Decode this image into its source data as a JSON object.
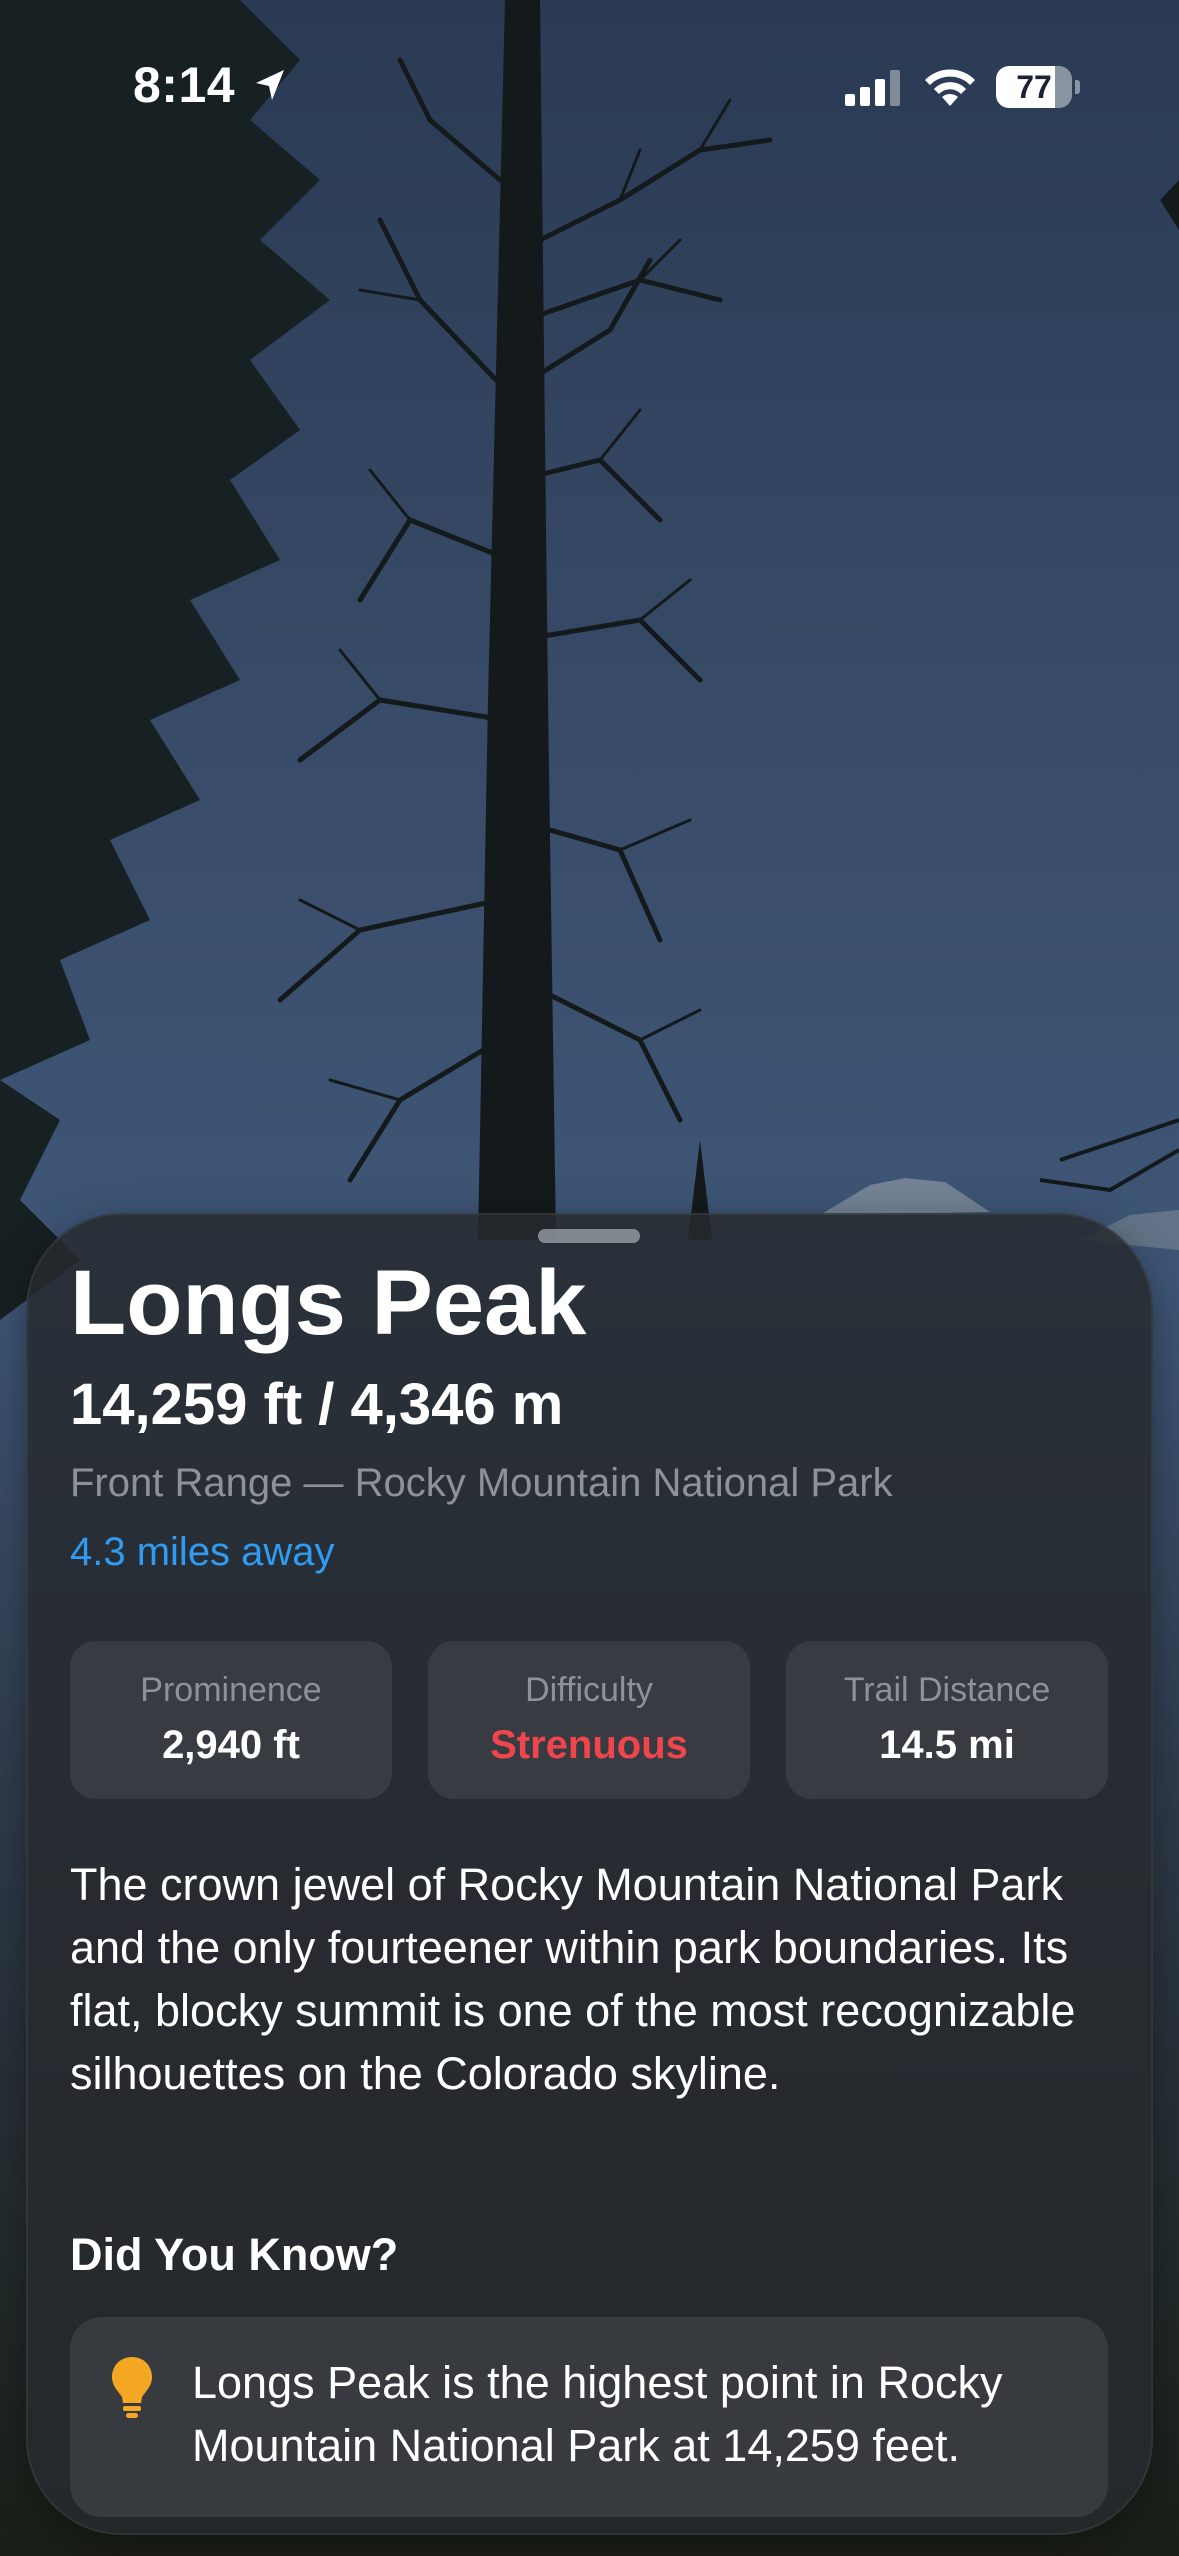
{
  "status_bar": {
    "time": "8:14",
    "battery_level": "77",
    "battery_fraction": 0.77
  },
  "icons": {
    "location": "location-arrow-icon",
    "signal": "cellular-signal-icon",
    "wifi": "wifi-icon",
    "battery": "battery-icon",
    "tip": "lightbulb-icon"
  },
  "peak": {
    "name": "Longs Peak",
    "elevation": "14,259 ft / 4,346 m",
    "range": "Front Range — Rocky Mountain National Park",
    "distance": "4.3 miles away"
  },
  "stats": [
    {
      "label": "Prominence",
      "value": "2,940 ft"
    },
    {
      "label": "Difficulty",
      "value": "Strenuous"
    },
    {
      "label": "Trail Distance",
      "value": "14.5 mi"
    }
  ],
  "description": "The crown jewel of Rocky Mountain National Park and the only fourteener within park boundaries. Its flat, blocky summit is one of the most recognizable silhouettes on the Colorado skyline.",
  "did_you_know": {
    "heading": "Did You Know?",
    "fact": "Longs Peak is the highest point in Rocky Mountain National Park at 14,259 feet."
  },
  "colors": {
    "accent_link": "#2f9bf2",
    "difficulty_strenuous": "#f0454d",
    "lightbulb": "#f5a623"
  }
}
